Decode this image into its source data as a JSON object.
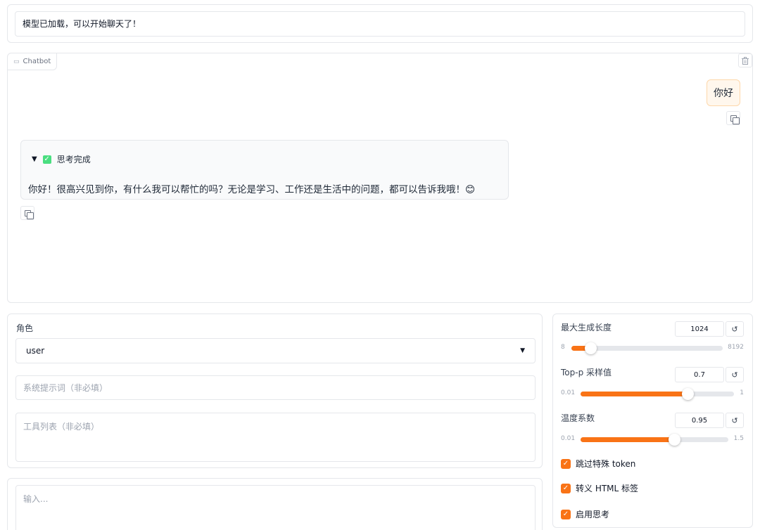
{
  "status": {
    "message": "模型已加载，可以开始聊天了！"
  },
  "chatbot": {
    "label": "Chatbot",
    "user_message": "你好",
    "thinking_label": "思考完成",
    "assistant_message": "你好！很高兴见到你，有什么我可以帮忙的吗？无论是学习、工作还是生活中的问题，都可以告诉我哦！😊"
  },
  "role": {
    "label": "角色",
    "selected": "user",
    "system_prompt_placeholder": "系统提示词（非必填）",
    "tools_placeholder": "工具列表（非必填）"
  },
  "input": {
    "placeholder": "输入..."
  },
  "params": {
    "max_length": {
      "label": "最大生成长度",
      "value": "1024",
      "min": "8",
      "max": "8192",
      "fraction": 0.124
    },
    "top_p": {
      "label": "Top-p 采样值",
      "value": "0.7",
      "min": "0.01",
      "max": "1",
      "fraction": 0.697
    },
    "temperature": {
      "label": "温度系数",
      "value": "0.95",
      "min": "0.01",
      "max": "1.5",
      "fraction": 0.631
    },
    "reset_glyph": "↺"
  },
  "options": [
    {
      "label": "跳过特殊 token",
      "checked": true
    },
    {
      "label": "转义 HTML 标签",
      "checked": true
    },
    {
      "label": "启用思考",
      "checked": true
    }
  ],
  "colors": {
    "accent": "#f97316",
    "user_bubble": "#fff7ed",
    "thinking_check": "#4ade80"
  }
}
